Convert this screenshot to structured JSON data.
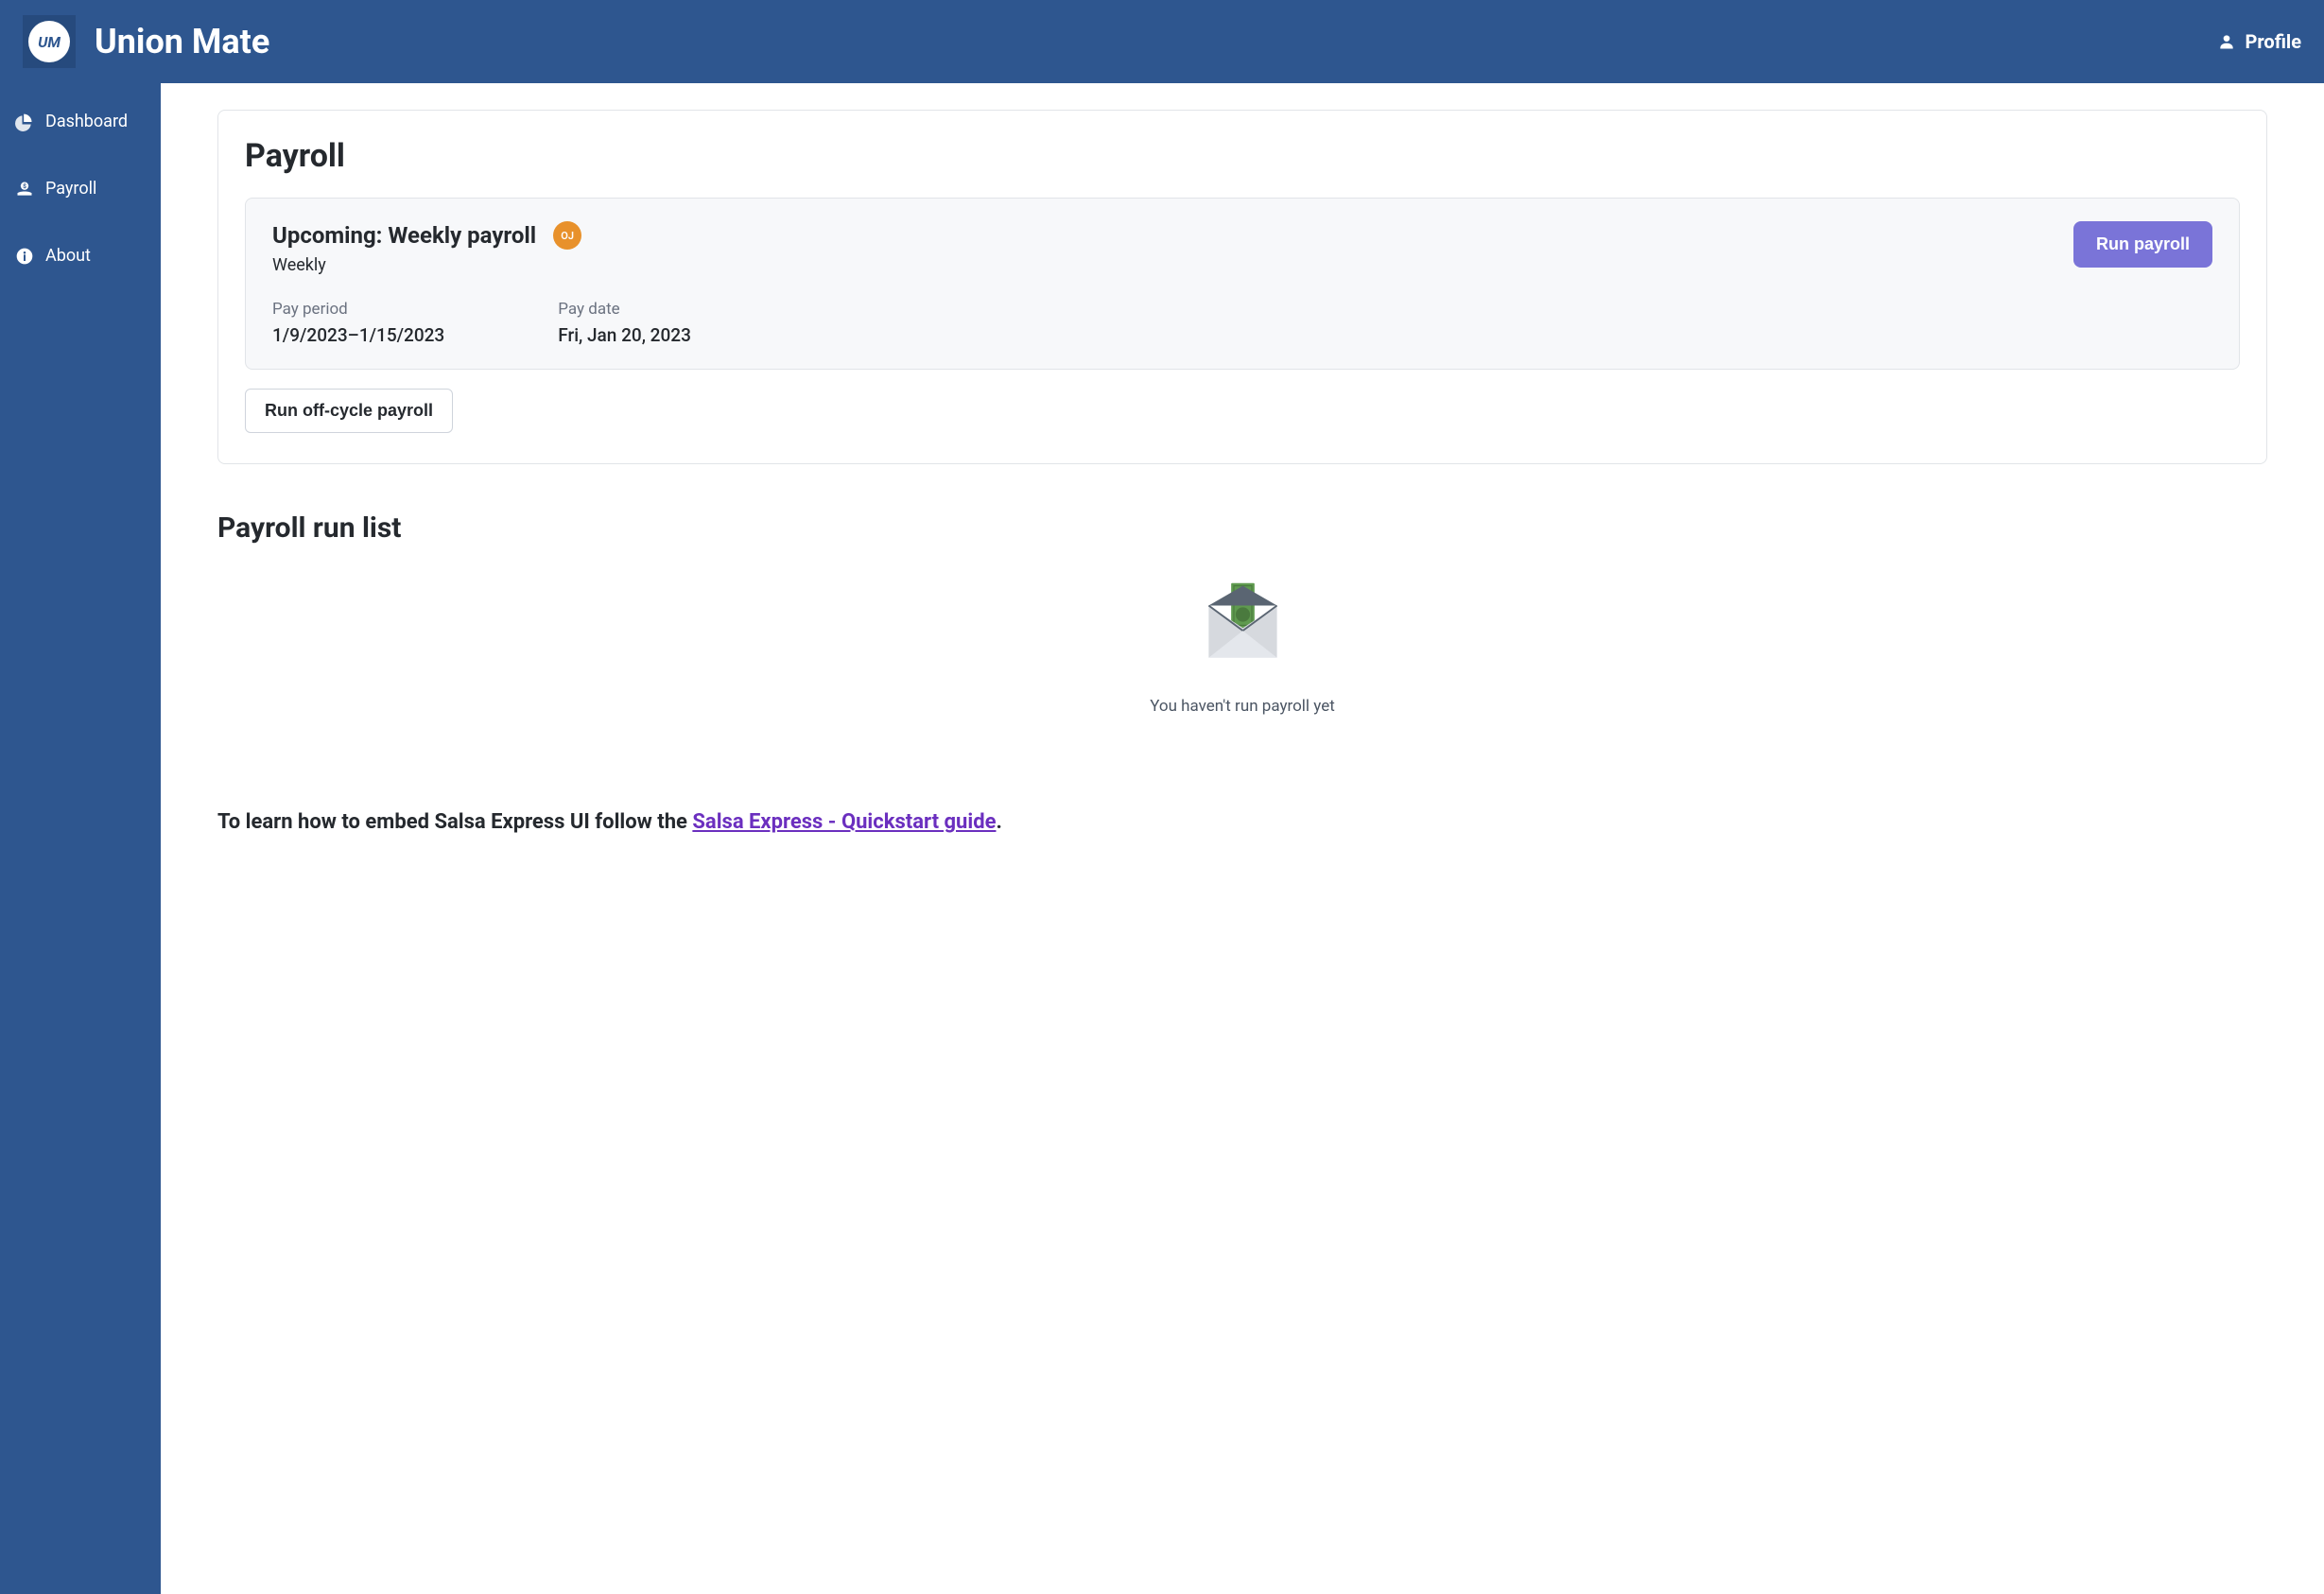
{
  "header": {
    "brand": "Union Mate",
    "logo_text": "UM",
    "profile_label": "Profile"
  },
  "sidebar": {
    "items": [
      {
        "label": "Dashboard",
        "icon": "chart-pie-icon"
      },
      {
        "label": "Payroll",
        "icon": "money-hand-icon"
      },
      {
        "label": "About",
        "icon": "info-circle-icon"
      }
    ]
  },
  "main": {
    "title": "Payroll",
    "upcoming": {
      "title": "Upcoming: Weekly payroll",
      "subtitle": "Weekly",
      "avatar_initials": "OJ",
      "run_button": "Run payroll",
      "pay_period_label": "Pay period",
      "pay_period_value": "1/9/2023–1/15/2023",
      "pay_date_label": "Pay date",
      "pay_date_value": "Fri, Jan 20, 2023"
    },
    "off_cycle_button": "Run off-cycle payroll"
  },
  "run_list": {
    "title": "Payroll run list",
    "empty_message": "You haven't run payroll yet"
  },
  "footer": {
    "prefix": "To learn how to embed Salsa Express UI follow the ",
    "link_text": "Salsa Express - Quickstart guide",
    "suffix": "."
  }
}
